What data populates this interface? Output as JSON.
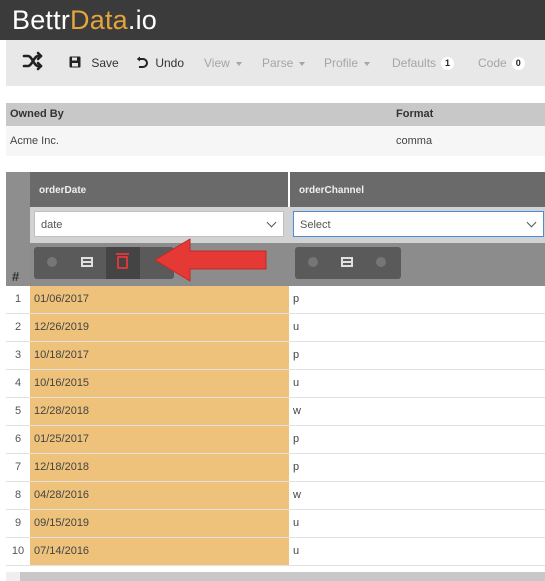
{
  "brand": {
    "prefix": "Bettr",
    "accent": "Data",
    "suffix": ".io"
  },
  "toolbar": {
    "save": "Save",
    "undo": "Undo",
    "view": "View",
    "parse": "Parse",
    "profile": "Profile",
    "defaults": "Defaults",
    "defaults_count": "1",
    "code": "Code",
    "code_count": "0"
  },
  "meta": {
    "headers": [
      "Owned By",
      "Format"
    ],
    "values": [
      "Acme Inc.",
      "comma"
    ]
  },
  "grid": {
    "row_header": "#",
    "columns": [
      {
        "name": "orderDate",
        "type": "date"
      },
      {
        "name": "orderChannel",
        "type": "Select"
      }
    ],
    "rows": [
      {
        "n": "1",
        "orderDate": "01/06/2017",
        "orderChannel": "p"
      },
      {
        "n": "2",
        "orderDate": "12/26/2019",
        "orderChannel": "u"
      },
      {
        "n": "3",
        "orderDate": "10/18/2017",
        "orderChannel": "p"
      },
      {
        "n": "4",
        "orderDate": "10/16/2015",
        "orderChannel": "u"
      },
      {
        "n": "5",
        "orderDate": "12/28/2018",
        "orderChannel": "w"
      },
      {
        "n": "6",
        "orderDate": "01/25/2017",
        "orderChannel": "p"
      },
      {
        "n": "7",
        "orderDate": "12/18/2018",
        "orderChannel": "p"
      },
      {
        "n": "8",
        "orderDate": "04/28/2016",
        "orderChannel": "w"
      },
      {
        "n": "9",
        "orderDate": "09/15/2019",
        "orderChannel": "u"
      },
      {
        "n": "10",
        "orderDate": "07/14/2016",
        "orderChannel": "u"
      }
    ]
  },
  "colors": {
    "brand_bar": "#3b3b3b",
    "brand_accent": "#e5a43d",
    "selected_column": "#eec27a",
    "delete_icon": "#d9383a",
    "callout_arrow": "#e53935"
  },
  "icons": {
    "shuffle": "shuffle-icon",
    "save": "save-icon",
    "undo": "undo-icon",
    "circle": "circle-icon",
    "split": "split-column-icon",
    "delete": "trash-icon",
    "callout": "arrow-left-icon"
  }
}
